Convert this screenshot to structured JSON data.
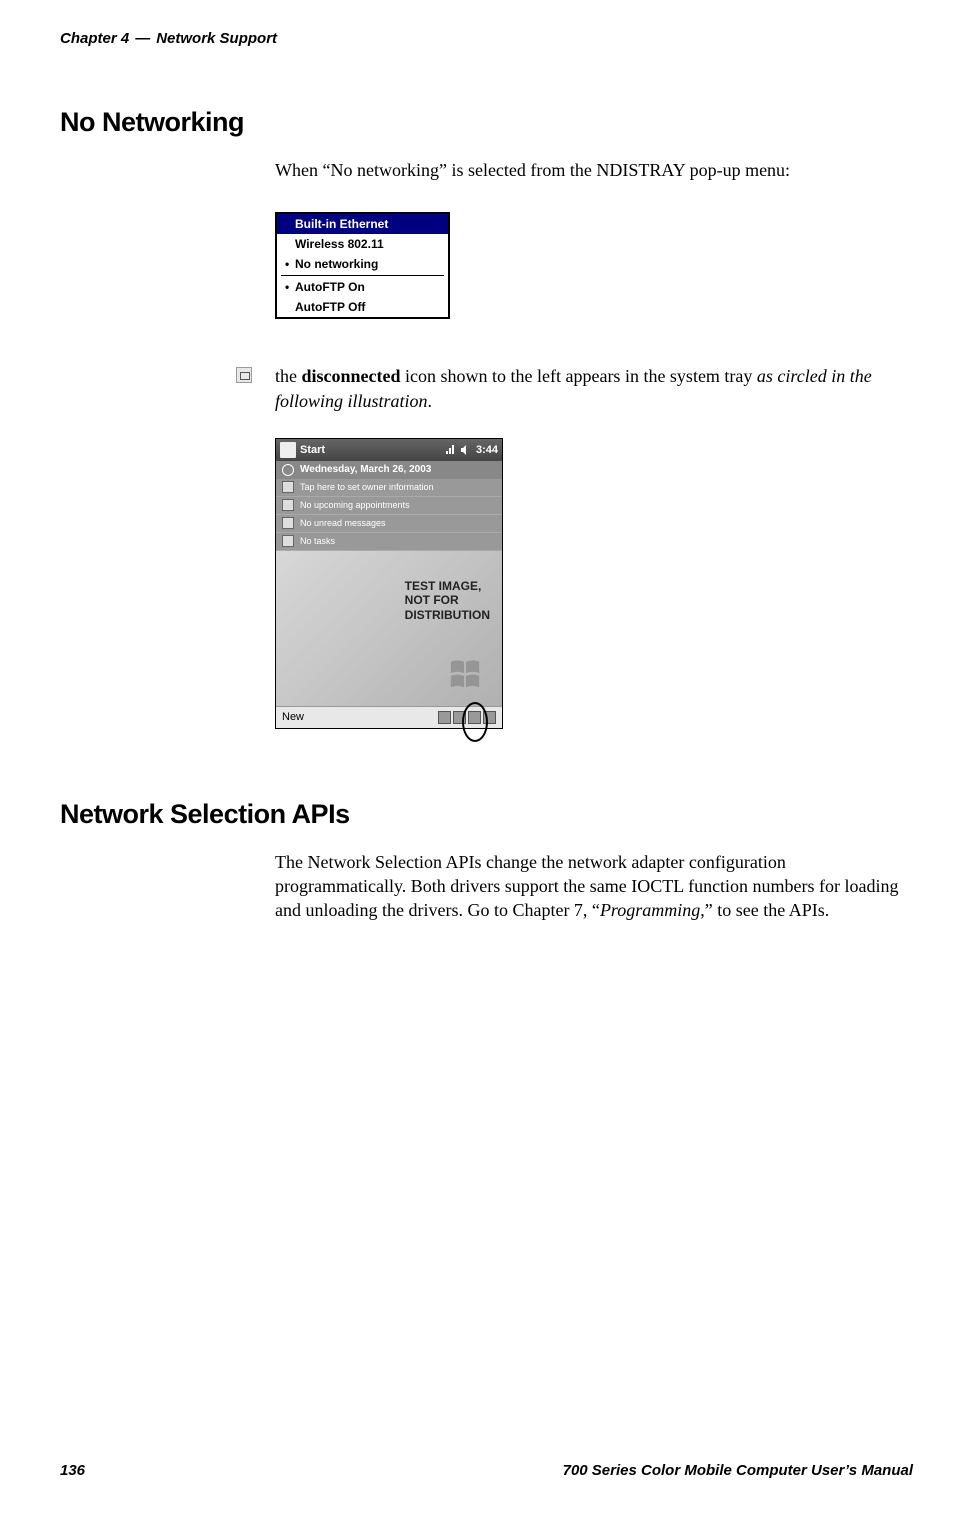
{
  "header": {
    "chapter": "Chapter 4",
    "dash": "—",
    "title": "Network Support"
  },
  "section1": {
    "heading": "No Networking",
    "intro": "When “No networking” is selected from the NDISTRAY pop-up menu:"
  },
  "menu": {
    "items": [
      {
        "label": "Built-in Ethernet",
        "selected": true,
        "bullet": false
      },
      {
        "label": "Wireless 802.11",
        "selected": false,
        "bullet": false
      },
      {
        "label": "No networking",
        "selected": false,
        "bullet": true
      }
    ],
    "items2": [
      {
        "label": "AutoFTP On",
        "bullet": true
      },
      {
        "label": "AutoFTP Off",
        "bullet": false
      }
    ]
  },
  "icon_para": {
    "pre": "the ",
    "bold": "disconnected",
    "mid": " icon shown to the left appears in the system tray ",
    "italic": "as circled in the following illustration",
    "end": "."
  },
  "device": {
    "start": "Start",
    "time": "3:44",
    "date": "Wednesday, March 26, 2003",
    "rows": [
      "Tap here to set owner information",
      "No upcoming appointments",
      "No unread messages",
      "No tasks"
    ],
    "test_label_1": "TEST IMAGE,",
    "test_label_2": "NOT FOR",
    "test_label_3": "DISTRIBUTION",
    "new": "New"
  },
  "section2": {
    "heading": "Network Selection APIs",
    "body_1": "The Network Selection APIs change the network adapter configuration programmatically. Both drivers support the same IOCTL function numbers for loading and unloading the drivers. Go to Chapter 7, “",
    "body_italic": "Programming",
    "body_2": ",” to see the APIs."
  },
  "footer": {
    "page": "136",
    "manual": "700 Series Color Mobile Computer User’s Manual"
  }
}
